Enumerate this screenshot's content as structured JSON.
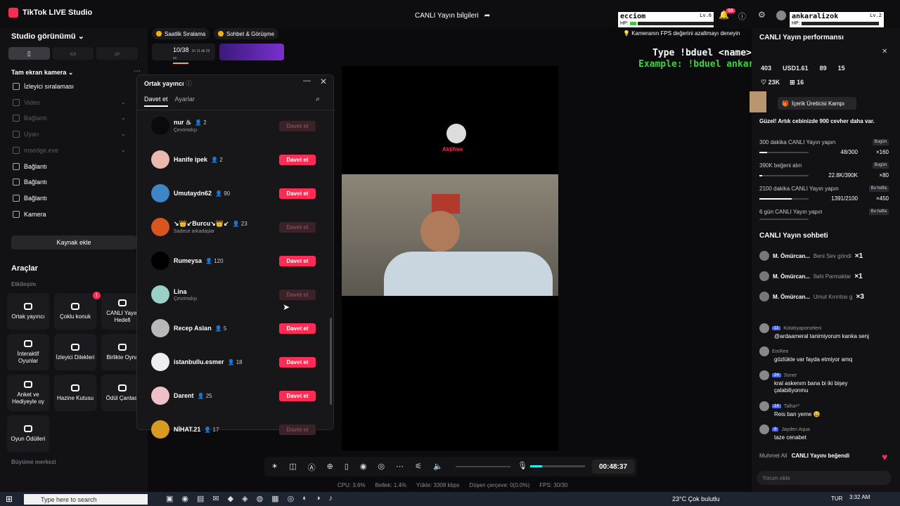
{
  "app": {
    "title": "TikTok LIVE Studio",
    "center_title": "CANLI Yayın bilgileri",
    "notif_count": "68"
  },
  "left": {
    "studio_view": "Studio görünümü",
    "fullscreen_camera": "Tam ekran kamera",
    "sources": [
      {
        "label": "İzleyici sıralaması",
        "dim": false
      },
      {
        "label": "Video",
        "dim": true
      },
      {
        "label": "Bağlantı",
        "dim": true
      },
      {
        "label": "Uyarı",
        "dim": true
      },
      {
        "label": "msedge.exe",
        "dim": true
      },
      {
        "label": "Bağlantı",
        "dim": false
      },
      {
        "label": "Bağlantı",
        "dim": false
      },
      {
        "label": "Bağlantı",
        "dim": false
      },
      {
        "label": "Kamera",
        "dim": false
      }
    ],
    "add_source": "Kaynak ekle",
    "tools_title": "Araçlar",
    "interaction": "Etkileşim",
    "growth": "Büyüme merkezi",
    "tools": [
      {
        "label": "Ortak yayıncı"
      },
      {
        "label": "Çoklu konuk",
        "badge": "1"
      },
      {
        "label": "CANLI Yayın Hedefi"
      },
      {
        "label": "İnteraktif Oyunlar"
      },
      {
        "label": "İzleyici Dilekleri"
      },
      {
        "label": "Birlikte Oyna"
      },
      {
        "label": "Anket ve Hediyeyle oy"
      },
      {
        "label": "Hazine Kutusu"
      },
      {
        "label": "Ödül Çantası"
      },
      {
        "label": "Oyun Ödülleri"
      }
    ]
  },
  "pills": {
    "hourly": "Saatlik Sıralama",
    "chat_meet": "Sohbet & Görüşme",
    "progress": "10/38",
    "timer": "1h 11 dk 29 sn"
  },
  "cohost": {
    "title": "Ortak yayıncı",
    "tab_invite": "Davet et",
    "tab_settings": "Ayarlar",
    "rows": [
      {
        "name": "nur ♨",
        "count": "2",
        "sub": "Çevrimdışı",
        "button": "Davet et",
        "enabled": false,
        "color": "#0a0a0a"
      },
      {
        "name": "Hanife ipek",
        "count": "2",
        "sub": "",
        "button": "Davet et",
        "enabled": true,
        "color": "#e9b9b0"
      },
      {
        "name": "Umutaydn62",
        "count": "90",
        "sub": "",
        "button": "Davet et",
        "enabled": true,
        "color": "#3f86c8"
      },
      {
        "name": "↘👑↙Burcu↘👑↙",
        "count": "23",
        "sub": "Sadece arkadaşlar",
        "button": "Davet et",
        "enabled": false,
        "color": "#d8551d"
      },
      {
        "name": "Rumeysa",
        "count": "120",
        "sub": "",
        "button": "Davet et",
        "enabled": true,
        "color": "#000000"
      },
      {
        "name": "Lina",
        "count": "",
        "sub": "Çevrimdışı",
        "button": "Davet et",
        "enabled": false,
        "color": "#9ad0c8"
      },
      {
        "name": "Recep Aslan",
        "count": "5",
        "sub": "",
        "button": "Davet et",
        "enabled": true,
        "color": "#b9b9b9"
      },
      {
        "name": "istanbullu.esmer",
        "count": "18",
        "sub": "",
        "button": "Davet et",
        "enabled": true,
        "color": "#eeeeee"
      },
      {
        "name": "Darent",
        "count": "25",
        "sub": "",
        "button": "Davet et",
        "enabled": true,
        "color": "#f0c0c8"
      },
      {
        "name": "NİHAT.21",
        "count": "17",
        "sub": "",
        "button": "Davet et",
        "enabled": false,
        "color": "#d79b20"
      }
    ]
  },
  "overlay": {
    "player1": "ecciom",
    "player1_lv": "Lv.6",
    "player2": "ankaralizok",
    "player2_lv": "Lv.2",
    "hp": "HP:",
    "line1": "Type !bduel <name> to play",
    "line2": "Example: !bduel ankaralizoktay",
    "fps_tip": "Kameranın FPS değerini azaltmayı deneyin",
    "sticker": "Aktifme"
  },
  "controls": {
    "timer": "00:48:37"
  },
  "stats": {
    "cpu": "CPU: 3.6%",
    "memory": "Bellek: 1.4%",
    "upload": "Yükle: 3308 kbps",
    "dropped": "Düşen çerçeve: 0(0.0%)",
    "fps": "FPS: 30/30"
  },
  "right": {
    "perf_title": "CANLI Yayın performansı",
    "stat1": "403",
    "stat2": "USD1.61",
    "stat3": "89",
    "stat4": "15",
    "likes": "23K",
    "gifts": "16",
    "campaign": "İçerik Üreticisi Kampı",
    "promo": "Güzel! Artık cebinizde 900 cevher daha var.",
    "tasks": [
      {
        "title": "300 dakika CANLI Yayın yapın",
        "tag": "Bugün",
        "progress": "48/300",
        "fill": 0.16,
        "reward": "×160"
      },
      {
        "title": "390K beğeni alın",
        "tag": "Bugün",
        "progress": "22.8K/390K",
        "fill": 0.06,
        "reward": "×80"
      },
      {
        "title": "2100 dakika CANLI Yayın yapın",
        "tag": "Bu hafta",
        "progress": "1391/2100",
        "fill": 0.66,
        "reward": "×450"
      },
      {
        "title": "6 gün CANLI Yayın yapın",
        "tag": "Bu hafta",
        "progress": "",
        "fill": 0,
        "reward": ""
      }
    ],
    "chat_title": "CANLI Yayın sohbeti",
    "gifts_list": [
      {
        "user": "M. Ömürcan...",
        "gift": "Beni Sev göndi",
        "mult": "×1"
      },
      {
        "user": "M. Ömürcan...",
        "gift": "İlahi Parmaklar",
        "mult": "×1"
      },
      {
        "user": "M. Ömürcan...",
        "gift": "Umut Kırıntısı g",
        "mult": "×3"
      }
    ],
    "messages": [
      {
        "user": "Kütahyaporseleni",
        "level": "11",
        "msg": "@ardaameral tanimiyorum kanka senj"
      },
      {
        "user": "EmRee",
        "level": "",
        "msg": "gözlükte var fayda etmiyor amq"
      },
      {
        "user": "Soner",
        "level": "24",
        "msg": "kral askenım bana bi iki bişey çalabiliyonmu"
      },
      {
        "user": "Talha⁸⁰",
        "level": "14",
        "msg": "Reis ban yeme 😀"
      },
      {
        "user": "Jayden Aqua",
        "level": "9",
        "msg": "taze cenabet"
      }
    ],
    "liked_user": "Muhmet Ali",
    "liked_text": "CANLI Yayını beğendi",
    "comment_placeholder": "Yorum ekle"
  },
  "taskbar": {
    "search": "Type here to search",
    "weather": "23°C  Çok bulutlu",
    "lang": "TUR",
    "time": "3:32 AM"
  },
  "colors": {
    "accent": "#fe2c55",
    "bg": "#121214"
  }
}
